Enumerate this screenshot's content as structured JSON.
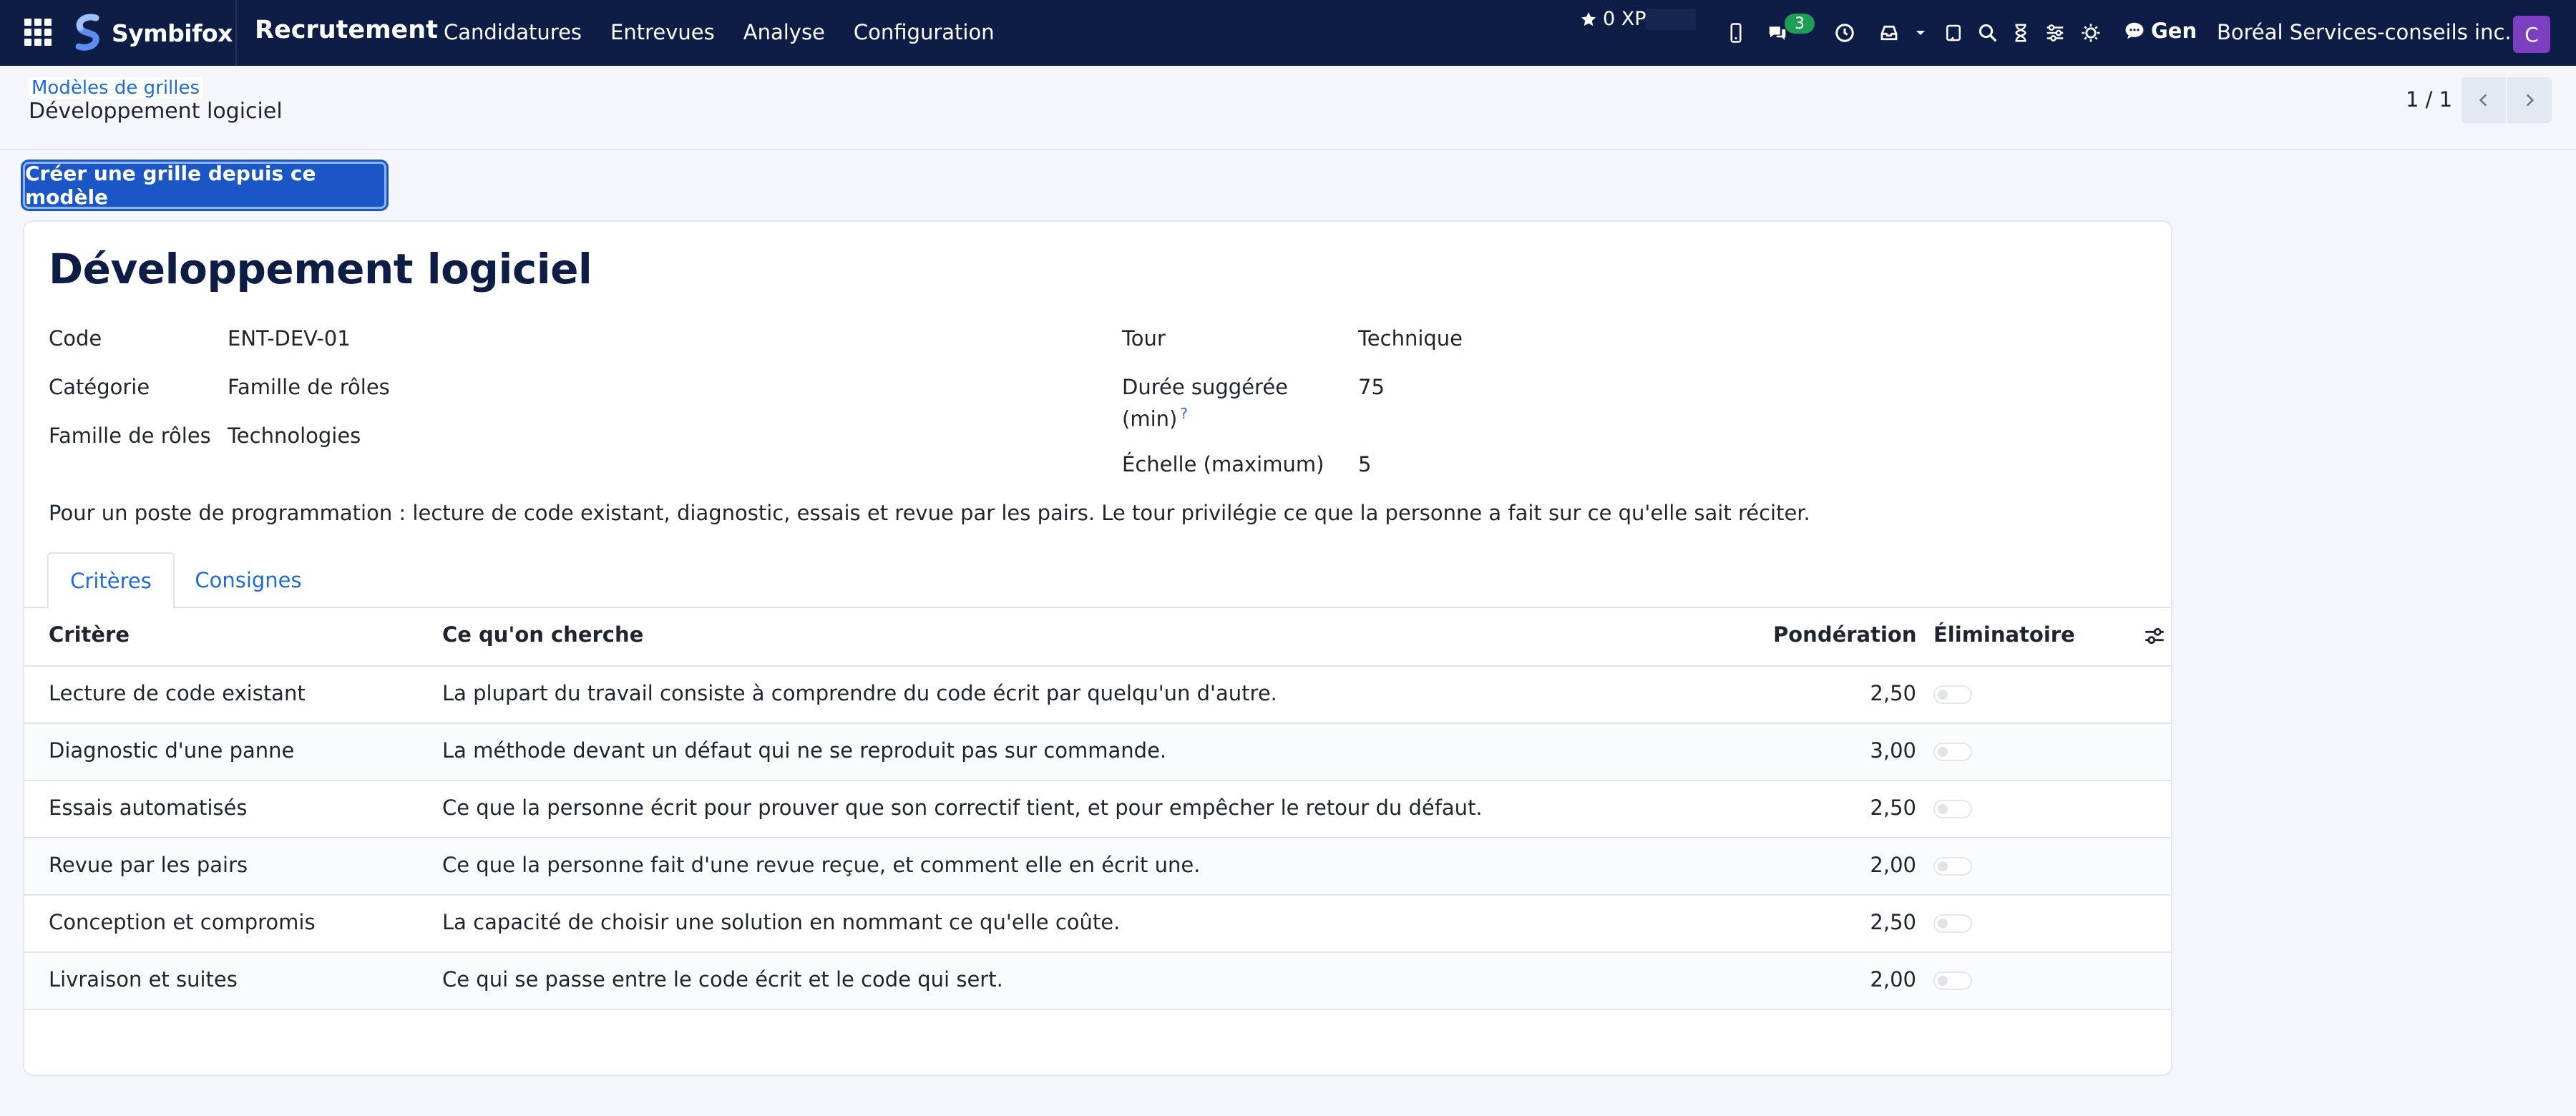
{
  "navbar": {
    "brand": "Symbifox",
    "app_title": "Recrutement",
    "menu": [
      "Candidatures",
      "Entrevues",
      "Analyse",
      "Configuration"
    ],
    "xp": "0 XP",
    "chat_badge": "3",
    "gen": "Gen",
    "company": "Boréal Services-conseils inc.",
    "avatar_initial": "C",
    "icons": [
      "apps-grid-icon",
      "phone-icon",
      "chat-icon",
      "clock-icon",
      "inbox-icon",
      "caret-down-icon",
      "tablet-icon",
      "search-icon",
      "hourglass-icon",
      "sliders-icon",
      "sun-icon",
      "speech-bubble-icon"
    ]
  },
  "breadcrumb": {
    "parent": "Modèles de grilles",
    "current": "Développement logiciel"
  },
  "pager": {
    "text": "1 / 1"
  },
  "actions": {
    "create_label": "Créer une grille depuis ce modèle"
  },
  "record": {
    "title": "Développement logiciel",
    "left_fields": [
      {
        "label": "Code",
        "value": "ENT-DEV-01"
      },
      {
        "label": "Catégorie",
        "value": "Famille de rôles"
      },
      {
        "label": "Famille de rôles",
        "value": "Technologies"
      }
    ],
    "right_fields": [
      {
        "label": "Tour",
        "value": "Technique"
      },
      {
        "label_line1": "Durée suggérée",
        "label_line2": "(min)",
        "help": "?",
        "value": "75"
      },
      {
        "label": "Échelle (maximum)",
        "value": "5"
      }
    ],
    "description": "Pour un poste de programmation : lecture de code existant, diagnostic, essais et revue par les pairs. Le tour privilégie ce que la personne a fait sur ce qu'elle sait réciter."
  },
  "tabs": [
    {
      "label": "Critères",
      "active": true
    },
    {
      "label": "Consignes",
      "active": false
    }
  ],
  "table": {
    "headers": [
      "Critère",
      "Ce qu'on cherche",
      "Pondération",
      "Éliminatoire"
    ],
    "rows": [
      {
        "critere": "Lecture de code existant",
        "cherche": "La plupart du travail consiste à comprendre du code écrit par quelqu'un d'autre.",
        "ponderation": "2,50",
        "eliminatoire": false
      },
      {
        "critere": "Diagnostic d'une panne",
        "cherche": "La méthode devant un défaut qui ne se reproduit pas sur commande.",
        "ponderation": "3,00",
        "eliminatoire": false
      },
      {
        "critere": "Essais automatisés",
        "cherche": "Ce que la personne écrit pour prouver que son correctif tient, et pour empêcher le retour du défaut.",
        "ponderation": "2,50",
        "eliminatoire": false
      },
      {
        "critere": "Revue par les pairs",
        "cherche": "Ce que la personne fait d'une revue reçue, et comment elle en écrit une.",
        "ponderation": "2,00",
        "eliminatoire": false
      },
      {
        "critere": "Conception et compromis",
        "cherche": "La capacité de choisir une solution en nommant ce qu'elle coûte.",
        "ponderation": "2,50",
        "eliminatoire": false
      },
      {
        "critere": "Livraison et suites",
        "cherche": "Ce qui se passe entre le code écrit et le code qui sert.",
        "ponderation": "2,00",
        "eliminatoire": false
      }
    ]
  },
  "colors": {
    "navbar_bg": "#0e1d45",
    "accent": "#1a56c6",
    "link": "#1e6bd6",
    "badge": "#1f9d55",
    "avatar": "#7b3fbf"
  }
}
